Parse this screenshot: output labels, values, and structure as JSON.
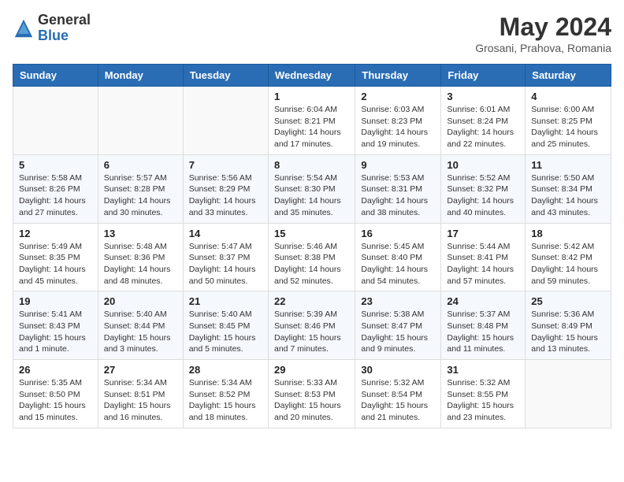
{
  "header": {
    "logo_general": "General",
    "logo_blue": "Blue",
    "month_year": "May 2024",
    "location": "Grosani, Prahova, Romania"
  },
  "weekdays": [
    "Sunday",
    "Monday",
    "Tuesday",
    "Wednesday",
    "Thursday",
    "Friday",
    "Saturday"
  ],
  "weeks": [
    [
      {
        "day": "",
        "info": ""
      },
      {
        "day": "",
        "info": ""
      },
      {
        "day": "",
        "info": ""
      },
      {
        "day": "1",
        "info": "Sunrise: 6:04 AM\nSunset: 8:21 PM\nDaylight: 14 hours and 17 minutes."
      },
      {
        "day": "2",
        "info": "Sunrise: 6:03 AM\nSunset: 8:23 PM\nDaylight: 14 hours and 19 minutes."
      },
      {
        "day": "3",
        "info": "Sunrise: 6:01 AM\nSunset: 8:24 PM\nDaylight: 14 hours and 22 minutes."
      },
      {
        "day": "4",
        "info": "Sunrise: 6:00 AM\nSunset: 8:25 PM\nDaylight: 14 hours and 25 minutes."
      }
    ],
    [
      {
        "day": "5",
        "info": "Sunrise: 5:58 AM\nSunset: 8:26 PM\nDaylight: 14 hours and 27 minutes."
      },
      {
        "day": "6",
        "info": "Sunrise: 5:57 AM\nSunset: 8:28 PM\nDaylight: 14 hours and 30 minutes."
      },
      {
        "day": "7",
        "info": "Sunrise: 5:56 AM\nSunset: 8:29 PM\nDaylight: 14 hours and 33 minutes."
      },
      {
        "day": "8",
        "info": "Sunrise: 5:54 AM\nSunset: 8:30 PM\nDaylight: 14 hours and 35 minutes."
      },
      {
        "day": "9",
        "info": "Sunrise: 5:53 AM\nSunset: 8:31 PM\nDaylight: 14 hours and 38 minutes."
      },
      {
        "day": "10",
        "info": "Sunrise: 5:52 AM\nSunset: 8:32 PM\nDaylight: 14 hours and 40 minutes."
      },
      {
        "day": "11",
        "info": "Sunrise: 5:50 AM\nSunset: 8:34 PM\nDaylight: 14 hours and 43 minutes."
      }
    ],
    [
      {
        "day": "12",
        "info": "Sunrise: 5:49 AM\nSunset: 8:35 PM\nDaylight: 14 hours and 45 minutes."
      },
      {
        "day": "13",
        "info": "Sunrise: 5:48 AM\nSunset: 8:36 PM\nDaylight: 14 hours and 48 minutes."
      },
      {
        "day": "14",
        "info": "Sunrise: 5:47 AM\nSunset: 8:37 PM\nDaylight: 14 hours and 50 minutes."
      },
      {
        "day": "15",
        "info": "Sunrise: 5:46 AM\nSunset: 8:38 PM\nDaylight: 14 hours and 52 minutes."
      },
      {
        "day": "16",
        "info": "Sunrise: 5:45 AM\nSunset: 8:40 PM\nDaylight: 14 hours and 54 minutes."
      },
      {
        "day": "17",
        "info": "Sunrise: 5:44 AM\nSunset: 8:41 PM\nDaylight: 14 hours and 57 minutes."
      },
      {
        "day": "18",
        "info": "Sunrise: 5:42 AM\nSunset: 8:42 PM\nDaylight: 14 hours and 59 minutes."
      }
    ],
    [
      {
        "day": "19",
        "info": "Sunrise: 5:41 AM\nSunset: 8:43 PM\nDaylight: 15 hours and 1 minute."
      },
      {
        "day": "20",
        "info": "Sunrise: 5:40 AM\nSunset: 8:44 PM\nDaylight: 15 hours and 3 minutes."
      },
      {
        "day": "21",
        "info": "Sunrise: 5:40 AM\nSunset: 8:45 PM\nDaylight: 15 hours and 5 minutes."
      },
      {
        "day": "22",
        "info": "Sunrise: 5:39 AM\nSunset: 8:46 PM\nDaylight: 15 hours and 7 minutes."
      },
      {
        "day": "23",
        "info": "Sunrise: 5:38 AM\nSunset: 8:47 PM\nDaylight: 15 hours and 9 minutes."
      },
      {
        "day": "24",
        "info": "Sunrise: 5:37 AM\nSunset: 8:48 PM\nDaylight: 15 hours and 11 minutes."
      },
      {
        "day": "25",
        "info": "Sunrise: 5:36 AM\nSunset: 8:49 PM\nDaylight: 15 hours and 13 minutes."
      }
    ],
    [
      {
        "day": "26",
        "info": "Sunrise: 5:35 AM\nSunset: 8:50 PM\nDaylight: 15 hours and 15 minutes."
      },
      {
        "day": "27",
        "info": "Sunrise: 5:34 AM\nSunset: 8:51 PM\nDaylight: 15 hours and 16 minutes."
      },
      {
        "day": "28",
        "info": "Sunrise: 5:34 AM\nSunset: 8:52 PM\nDaylight: 15 hours and 18 minutes."
      },
      {
        "day": "29",
        "info": "Sunrise: 5:33 AM\nSunset: 8:53 PM\nDaylight: 15 hours and 20 minutes."
      },
      {
        "day": "30",
        "info": "Sunrise: 5:32 AM\nSunset: 8:54 PM\nDaylight: 15 hours and 21 minutes."
      },
      {
        "day": "31",
        "info": "Sunrise: 5:32 AM\nSunset: 8:55 PM\nDaylight: 15 hours and 23 minutes."
      },
      {
        "day": "",
        "info": ""
      }
    ]
  ]
}
